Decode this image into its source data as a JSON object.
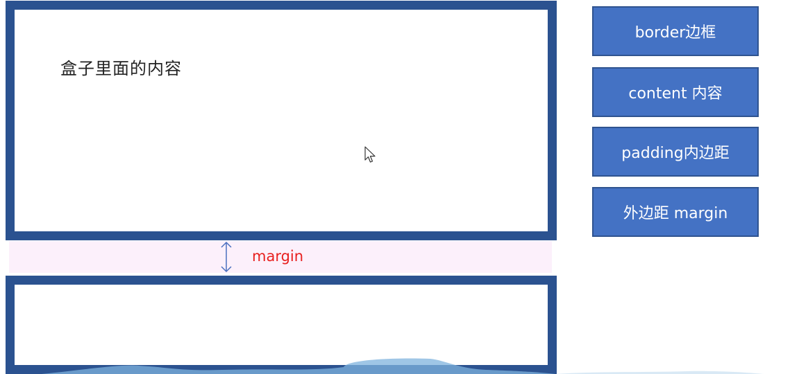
{
  "diagram": {
    "box_content_text": "盒子里面的内容",
    "margin_label": "margin"
  },
  "legend": {
    "border": "border边框",
    "content": "content 内容",
    "padding": "padding内边距",
    "margin": "外边距 margin"
  },
  "colors": {
    "box_border": "#2b5290",
    "margin_band": "#fcf0fb",
    "margin_text": "#e8201f",
    "legend_fill": "#4472c4",
    "legend_outline": "#2f538f",
    "arrow": "#4a6fbf"
  }
}
